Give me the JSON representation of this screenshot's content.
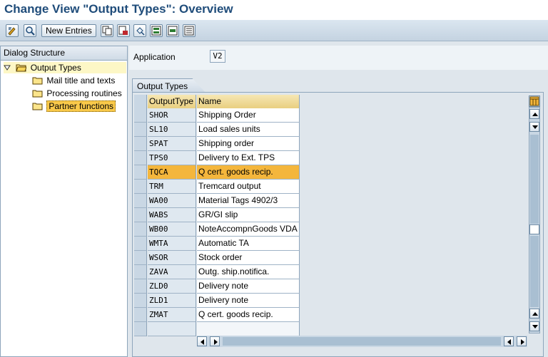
{
  "window": {
    "title": "Change View \"Output Types\": Overview"
  },
  "toolbar": {
    "new_entries_label": "New Entries",
    "icons": [
      "display-change-icon",
      "detail-icon",
      "copy-icon",
      "delete-icon",
      "undo-icon",
      "select-all-icon",
      "select-block-icon",
      "deselect-all-icon"
    ]
  },
  "dialog_structure": {
    "header": "Dialog Structure",
    "root": {
      "label": "Output Types"
    },
    "children": [
      {
        "label": "Mail title and texts",
        "selected": false
      },
      {
        "label": "Processing routines",
        "selected": false
      },
      {
        "label": "Partner functions",
        "selected": true
      }
    ]
  },
  "application": {
    "label": "Application",
    "value": "V2"
  },
  "table": {
    "tab_label": "Output Types",
    "columns": {
      "code": "OutputType",
      "name": "Name"
    },
    "rows": [
      {
        "code": "SHOR",
        "name": "Shipping Order"
      },
      {
        "code": "SL10",
        "name": "Load sales units"
      },
      {
        "code": "SPAT",
        "name": "Shipping order"
      },
      {
        "code": "TPS0",
        "name": "Delivery to Ext. TPS"
      },
      {
        "code": "TQCA",
        "name": "Q cert. goods recip."
      },
      {
        "code": "TRM",
        "name": "Tremcard output"
      },
      {
        "code": "WA00",
        "name": "Material Tags 4902/3"
      },
      {
        "code": "WABS",
        "name": "GR/GI slip"
      },
      {
        "code": "WB00",
        "name": "NoteAccompnGoods VDA"
      },
      {
        "code": "WMTA",
        "name": "Automatic TA"
      },
      {
        "code": "WSOR",
        "name": "Stock order"
      },
      {
        "code": "ZAVA",
        "name": "Outg. ship.notifica."
      },
      {
        "code": "ZLD0",
        "name": "Delivery note"
      },
      {
        "code": "ZLD1",
        "name": "Delivery note"
      },
      {
        "code": "ZMAT",
        "name": "Q cert. goods recip."
      }
    ],
    "highlighted_row_index": 4
  },
  "colors": {
    "title": "#1f4c7a",
    "highlight": "#f4b63c",
    "tree_selection": "#f9c94a"
  }
}
